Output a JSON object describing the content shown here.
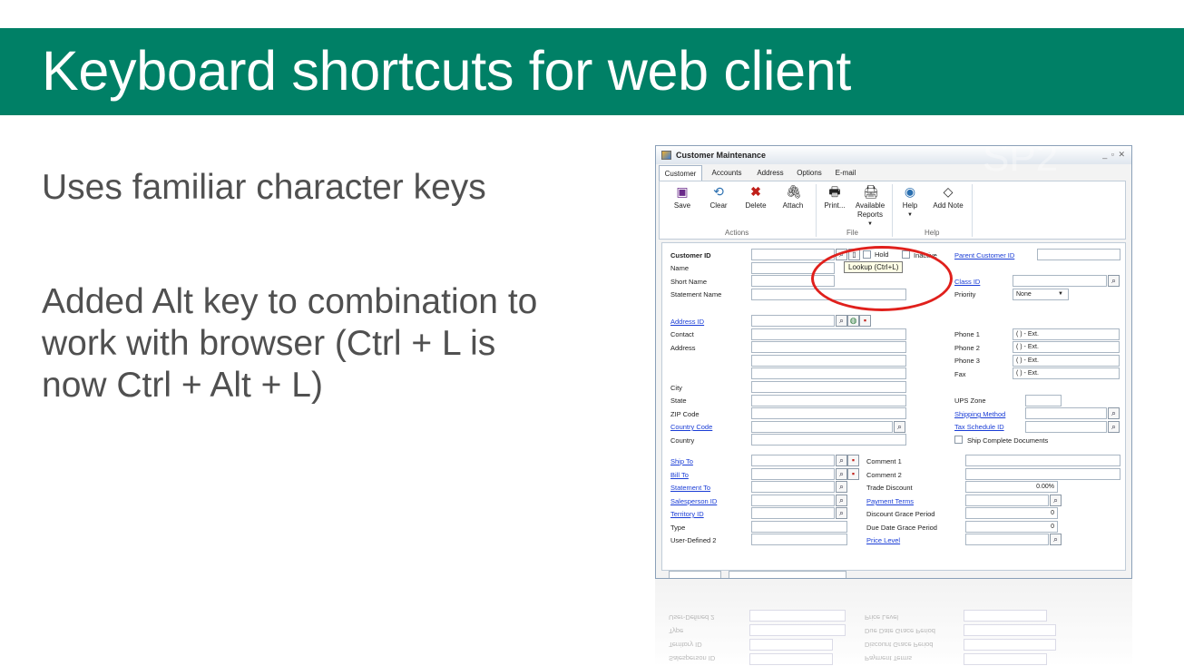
{
  "slide": {
    "title": "Keyboard shortcuts for web client",
    "bullet1": "Uses familiar character keys",
    "bullet2": "Added Alt key to combination to work with browser (Ctrl + L is now Ctrl + Alt + L)",
    "watermark": "SP2"
  },
  "colors": {
    "header_bg": "#008066",
    "bullet_text": "#505050",
    "link": "#1a3dd6",
    "annotation_circle": "#e0201c"
  },
  "window": {
    "title": "Customer Maintenance",
    "controls": "_ ▫ ✕",
    "tabs": [
      "Customer",
      "Accounts",
      "Address",
      "Options",
      "E-mail"
    ],
    "ribbon": {
      "buttons": [
        {
          "label": "Save",
          "icon": "save-icon"
        },
        {
          "label": "Clear",
          "icon": "clear-icon"
        },
        {
          "label": "Delete",
          "icon": "delete-icon"
        },
        {
          "label": "Attach",
          "icon": "attach-icon"
        },
        {
          "label": "Print...",
          "icon": "print-icon"
        },
        {
          "label": "Available Reports",
          "icon": "reports-icon"
        },
        {
          "label": "Help",
          "icon": "help-icon"
        },
        {
          "label": "Add Note",
          "icon": "note-icon"
        }
      ],
      "groups": [
        "Actions",
        "File",
        "Help"
      ]
    },
    "form": {
      "customer_id": "Customer ID",
      "name": "Name",
      "short_name": "Short Name",
      "statement_name": "Statement Name",
      "hold": "Hold",
      "inactive": "Inactive",
      "parent_customer_id": "Parent Customer ID",
      "class_id": "Class ID",
      "priority": "Priority",
      "priority_value": "None",
      "tooltip": "Lookup (Ctrl+L)",
      "address_id": "Address ID",
      "contact": "Contact",
      "address": "Address",
      "city": "City",
      "state": "State",
      "zip": "ZIP Code",
      "country_code": "Country Code",
      "country": "Country",
      "phone1": "Phone 1",
      "phone2": "Phone 2",
      "phone3": "Phone 3",
      "fax": "Fax",
      "phone_mask": "(   )   -        Ext.",
      "ups_zone": "UPS Zone",
      "shipping_method": "Shipping Method",
      "tax_schedule_id": "Tax Schedule ID",
      "ship_complete": "Ship Complete Documents",
      "ship_to": "Ship To",
      "bill_to": "Bill To",
      "statement_to": "Statement To",
      "salesperson_id": "Salesperson ID",
      "territory_id": "Territory ID",
      "type": "Type",
      "user_defined_2": "User-Defined 2",
      "comment1": "Comment 1",
      "comment2": "Comment 2",
      "trade_discount": "Trade Discount",
      "trade_discount_value": "0.00%",
      "payment_terms": "Payment Terms",
      "discount_grace": "Discount Grace Period",
      "discount_grace_value": "0",
      "due_date_grace": "Due Date Grace Period",
      "due_date_grace_value": "0",
      "price_level": "Price Level"
    }
  }
}
